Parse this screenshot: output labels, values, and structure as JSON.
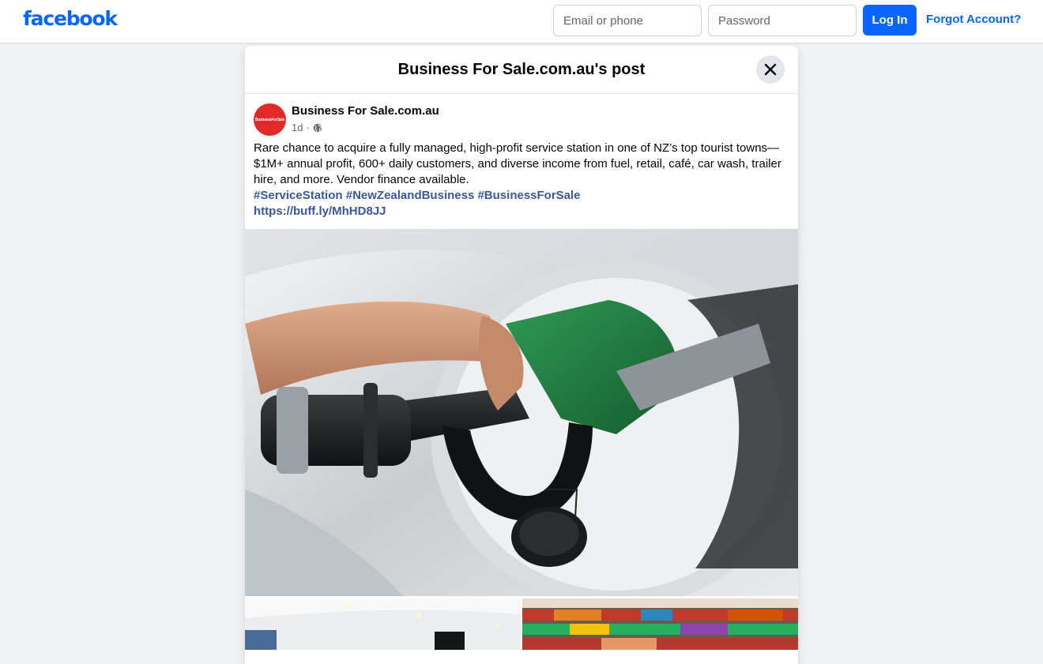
{
  "header": {
    "logo": "facebook",
    "email_placeholder": "Email or phone",
    "password_placeholder": "Password",
    "login_label": "Log In",
    "forgot_label": "Forgot Account?"
  },
  "dialog": {
    "title": "Business For Sale.com.au's post"
  },
  "post": {
    "avatar_text": "BusinessForSale",
    "page_name": "Business For Sale.com.au",
    "time": "1d",
    "separator": "·",
    "audience_icon": "globe-icon",
    "body": "Rare chance to acquire a fully managed, high-profit service station in one of NZ’s top tourist towns—$1M+ annual profit, 600+ daily customers, and diverse income from fuel, retail, café, car wash, trailer hire, and more. Vendor finance available.",
    "hashtags": [
      "#ServiceStation",
      "#NewZealandBusiness",
      "#BusinessForSale"
    ],
    "link": "https://buff.ly/MhHD8JJ"
  },
  "colors": {
    "brand": "#0866ff",
    "link": "#385898",
    "avatar": "#e02a2a",
    "pump_nozzle": "#1f7a3e"
  }
}
